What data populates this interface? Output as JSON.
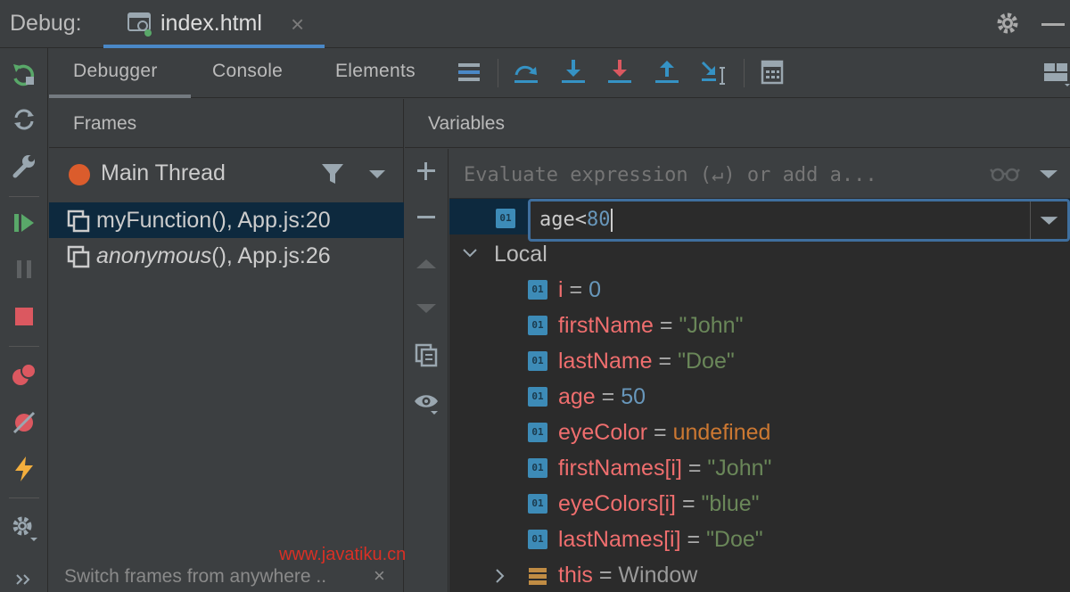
{
  "titlebar": {
    "debug_label": "Debug:",
    "file_tab": "index.html",
    "close_glyph": "×"
  },
  "tabs": [
    {
      "label": "Debugger",
      "active": true
    },
    {
      "label": "Console",
      "active": false
    },
    {
      "label": "Elements",
      "active": false
    }
  ],
  "frames": {
    "title": "Frames",
    "thread": "Main Thread",
    "items": [
      {
        "name": "myFunction",
        "rest": "(), App.js:20",
        "italic": false,
        "selected": true
      },
      {
        "name": "anonymous",
        "rest": "(), App.js:26",
        "italic": true,
        "selected": false
      }
    ],
    "hint": "Switch frames from anywhere ..",
    "hint_close": "×"
  },
  "variables": {
    "title": "Variables",
    "eval_placeholder": "Evaluate expression (↵) or add a...",
    "watch": {
      "prefix": "age<",
      "number": "80"
    },
    "badge_text": "01",
    "local_label": "Local",
    "items": [
      {
        "name": "i",
        "eq": "=",
        "value": "0",
        "kind": "num"
      },
      {
        "name": "firstName",
        "eq": "=",
        "value": "\"John\"",
        "kind": "str"
      },
      {
        "name": "lastName",
        "eq": "=",
        "value": "\"Doe\"",
        "kind": "str"
      },
      {
        "name": "age",
        "eq": "=",
        "value": "50",
        "kind": "num"
      },
      {
        "name": "eyeColor",
        "eq": "=",
        "value": "undefined",
        "kind": "undef"
      },
      {
        "name": "firstNames[i]",
        "eq": "=",
        "value": "\"John\"",
        "kind": "str"
      },
      {
        "name": "eyeColors[i]",
        "eq": "=",
        "value": "\"blue\"",
        "kind": "str"
      },
      {
        "name": "lastNames[i]",
        "eq": "=",
        "value": "\"Doe\"",
        "kind": "str"
      }
    ],
    "this_row": {
      "name": "this",
      "eq": "=",
      "value": "Window"
    }
  },
  "watermark": "www.javatiku.cn",
  "colors": {
    "accent": "#4a88c7",
    "selection": "#0d293e",
    "var_name": "#ef6e6e",
    "number": "#6897bb",
    "string": "#6a8759",
    "undefined": "#cc7832",
    "thread_dot": "#db5c2c"
  },
  "icons": {
    "toolbar": [
      "restart-icon",
      "rerun-icon",
      "settings-wrench-icon",
      "resume-icon",
      "pause-icon",
      "stop-icon",
      "view-breakpoints-icon",
      "mute-breakpoints-icon",
      "lightning-icon",
      "gear-icon",
      "more-icon"
    ],
    "debug_toolbar": [
      "frames-layout-icon",
      "step-over-icon",
      "step-into-icon",
      "force-step-into-icon",
      "step-out-icon",
      "run-to-cursor-icon",
      "evaluate-icon",
      "layout-icon"
    ]
  }
}
